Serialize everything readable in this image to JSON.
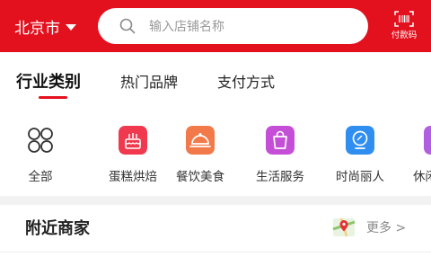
{
  "header": {
    "city": "北京市",
    "search_placeholder": "输入店铺名称",
    "paycode_label": "付款码"
  },
  "tabs": [
    {
      "label": "行业类别",
      "active": true
    },
    {
      "label": "热门品牌",
      "active": false
    },
    {
      "label": "支付方式",
      "active": false
    }
  ],
  "categories": [
    {
      "label": "全部",
      "icon": "grid-circles-icon"
    },
    {
      "label": "蛋糕烘焙",
      "icon": "cake-icon",
      "color": "#f0394f"
    },
    {
      "label": "餐饮美食",
      "icon": "dish-cover-icon",
      "color": "#f27a4a"
    },
    {
      "label": "生活服务",
      "icon": "shopping-bag-icon",
      "color": "#c44fd6"
    },
    {
      "label": "时尚丽人",
      "icon": "mirror-icon",
      "color": "#2f8ef0"
    },
    {
      "label": "休闲",
      "icon": "leisure-icon",
      "color": "#b05fe0"
    }
  ],
  "nearby": {
    "title": "附近商家",
    "more_label": "更多 >"
  },
  "colors": {
    "brand_red": "#e3101e"
  }
}
